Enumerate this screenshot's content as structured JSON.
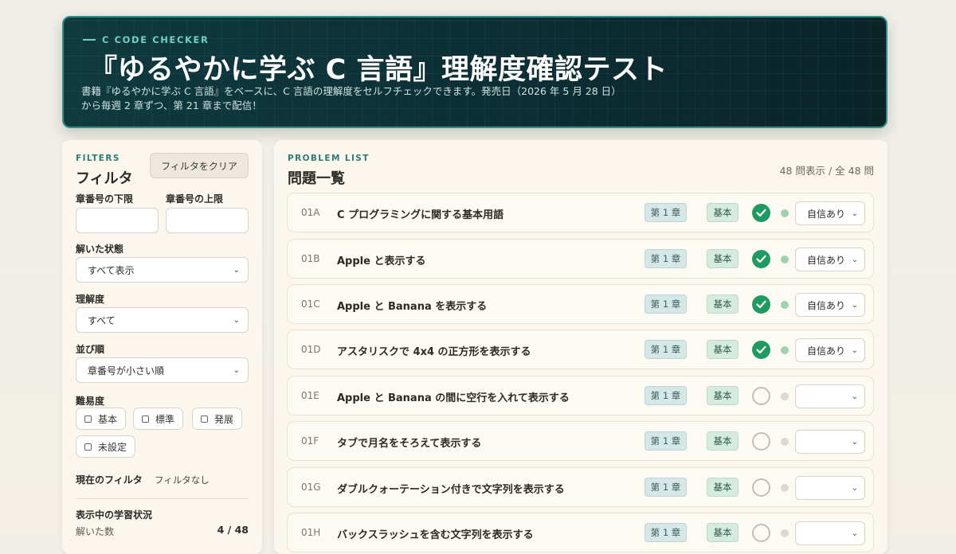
{
  "header": {
    "kicker": "C CODE CHECKER",
    "title": "『ゆるやかに学ぶ C 言語』理解度確認テスト",
    "description": "書籍『ゆるやかに学ぶ C 言語』をベースに、C 言語の理解度をセルフチェックできます。発売日（2026 年 5 月 28 日）から毎週 2 章ずつ、第 21 章まで配信！",
    "colors": {
      "banner_bg": "#0c2d33",
      "accent": "#6fd1c1"
    }
  },
  "filters": {
    "kicker": "FILTERS",
    "title": "フィルタ",
    "clear_label": "フィルタをクリア",
    "chapter_min_label": "章番号の下限",
    "chapter_max_label": "章番号の上限",
    "chapter_min_value": "",
    "chapter_max_value": "",
    "solved_label": "解いた状態",
    "solved_value": "すべて表示",
    "understanding_label": "理解度",
    "understanding_value": "すべて",
    "sort_label": "並び順",
    "sort_value": "章番号が小さい順",
    "difficulty_label": "難易度",
    "difficulty_options": [
      "基本",
      "標準",
      "発展",
      "未設定"
    ],
    "current_label": "現在のフィルタ",
    "current_value": "フィルタなし",
    "stats_title": "表示中の学習状況",
    "solved_count_label": "解いた数",
    "solved_count_value": "4 / 48"
  },
  "problems": {
    "kicker": "PROBLEM LIST",
    "title": "問題一覧",
    "count_text": "48 問表示 / 全 48 問",
    "items": [
      {
        "id": "01A",
        "name": "C プログラミングに関する基本用語",
        "chapter": "第 1 章",
        "level": "基本",
        "solved": true,
        "confidence": "自信あり"
      },
      {
        "id": "01B",
        "name": "Apple と表示する",
        "chapter": "第 1 章",
        "level": "基本",
        "solved": true,
        "confidence": "自信あり"
      },
      {
        "id": "01C",
        "name": "Apple と Banana を表示する",
        "chapter": "第 1 章",
        "level": "基本",
        "solved": true,
        "confidence": "自信あり"
      },
      {
        "id": "01D",
        "name": "アスタリスクで 4x4 の正方形を表示する",
        "chapter": "第 1 章",
        "level": "基本",
        "solved": true,
        "confidence": "自信あり"
      },
      {
        "id": "01E",
        "name": "Apple と Banana の間に空行を入れて表示する",
        "chapter": "第 1 章",
        "level": "基本",
        "solved": false,
        "confidence": ""
      },
      {
        "id": "01F",
        "name": "タブで月名をそろえて表示する",
        "chapter": "第 1 章",
        "level": "基本",
        "solved": false,
        "confidence": ""
      },
      {
        "id": "01G",
        "name": "ダブルクォーテーション付きで文字列を表示する",
        "chapter": "第 1 章",
        "level": "基本",
        "solved": false,
        "confidence": ""
      },
      {
        "id": "01H",
        "name": "バックスラッシュを含む文字列を表示する",
        "chapter": "第 1 章",
        "level": "基本",
        "solved": false,
        "confidence": ""
      }
    ]
  }
}
